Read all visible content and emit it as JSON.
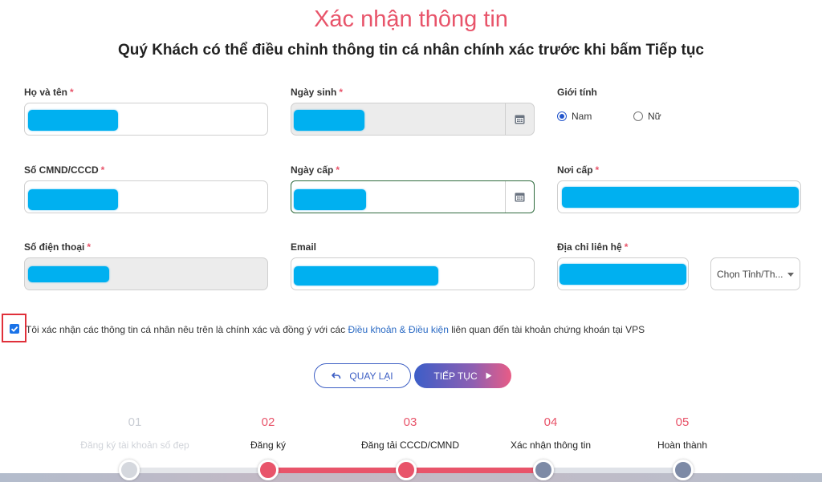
{
  "header": {
    "title": "Xác nhận thông tin",
    "subtitle": "Quý Khách có thể điều chỉnh thông tin cá nhân chính xác trước khi bấm Tiếp tục"
  },
  "form": {
    "full_name_label": "Họ và tên",
    "dob_label": "Ngày sinh",
    "gender_label": "Giới tính",
    "gender_male": "Nam",
    "gender_female": "Nữ",
    "gender_selected": "Nam",
    "id_label": "Số CMND/CCCD",
    "issue_date_label": "Ngày cấp",
    "issue_place_label": "Nơi cấp",
    "phone_label": "Số điện thoại",
    "email_label": "Email",
    "address_label": "Địa chỉ liên hệ",
    "province_value": "Chọn Tỉnh/Th...",
    "required_mark": "*"
  },
  "consent": {
    "checked": true,
    "text_before": "Tôi xác nhận các thông tin cá nhân nêu trên là chính xác và đồng ý với các ",
    "link_text": "Điều khoản & Điều kiện",
    "text_after": " liên quan đến tài khoản chứng khoán tại VPS"
  },
  "buttons": {
    "back_label": "QUAY LẠI",
    "next_label": "TIẾP TỤC"
  },
  "steps": [
    {
      "number": "01",
      "label": "Đăng ký tài khoản số đẹp",
      "state": "inactive"
    },
    {
      "number": "02",
      "label": "Đăng ký",
      "state": "done"
    },
    {
      "number": "03",
      "label": "Đăng tải CCCD/CMND",
      "state": "done"
    },
    {
      "number": "04",
      "label": "Xác nhận thông tin",
      "state": "current"
    },
    {
      "number": "05",
      "label": "Hoàn thành",
      "state": "pending"
    }
  ],
  "colors": {
    "accent": "#e8546a",
    "primary_blue": "#3c5ec8",
    "mask": "#00b0f0",
    "step_inactive": "#d5d8de",
    "step_pending": "#7d8aa6"
  }
}
